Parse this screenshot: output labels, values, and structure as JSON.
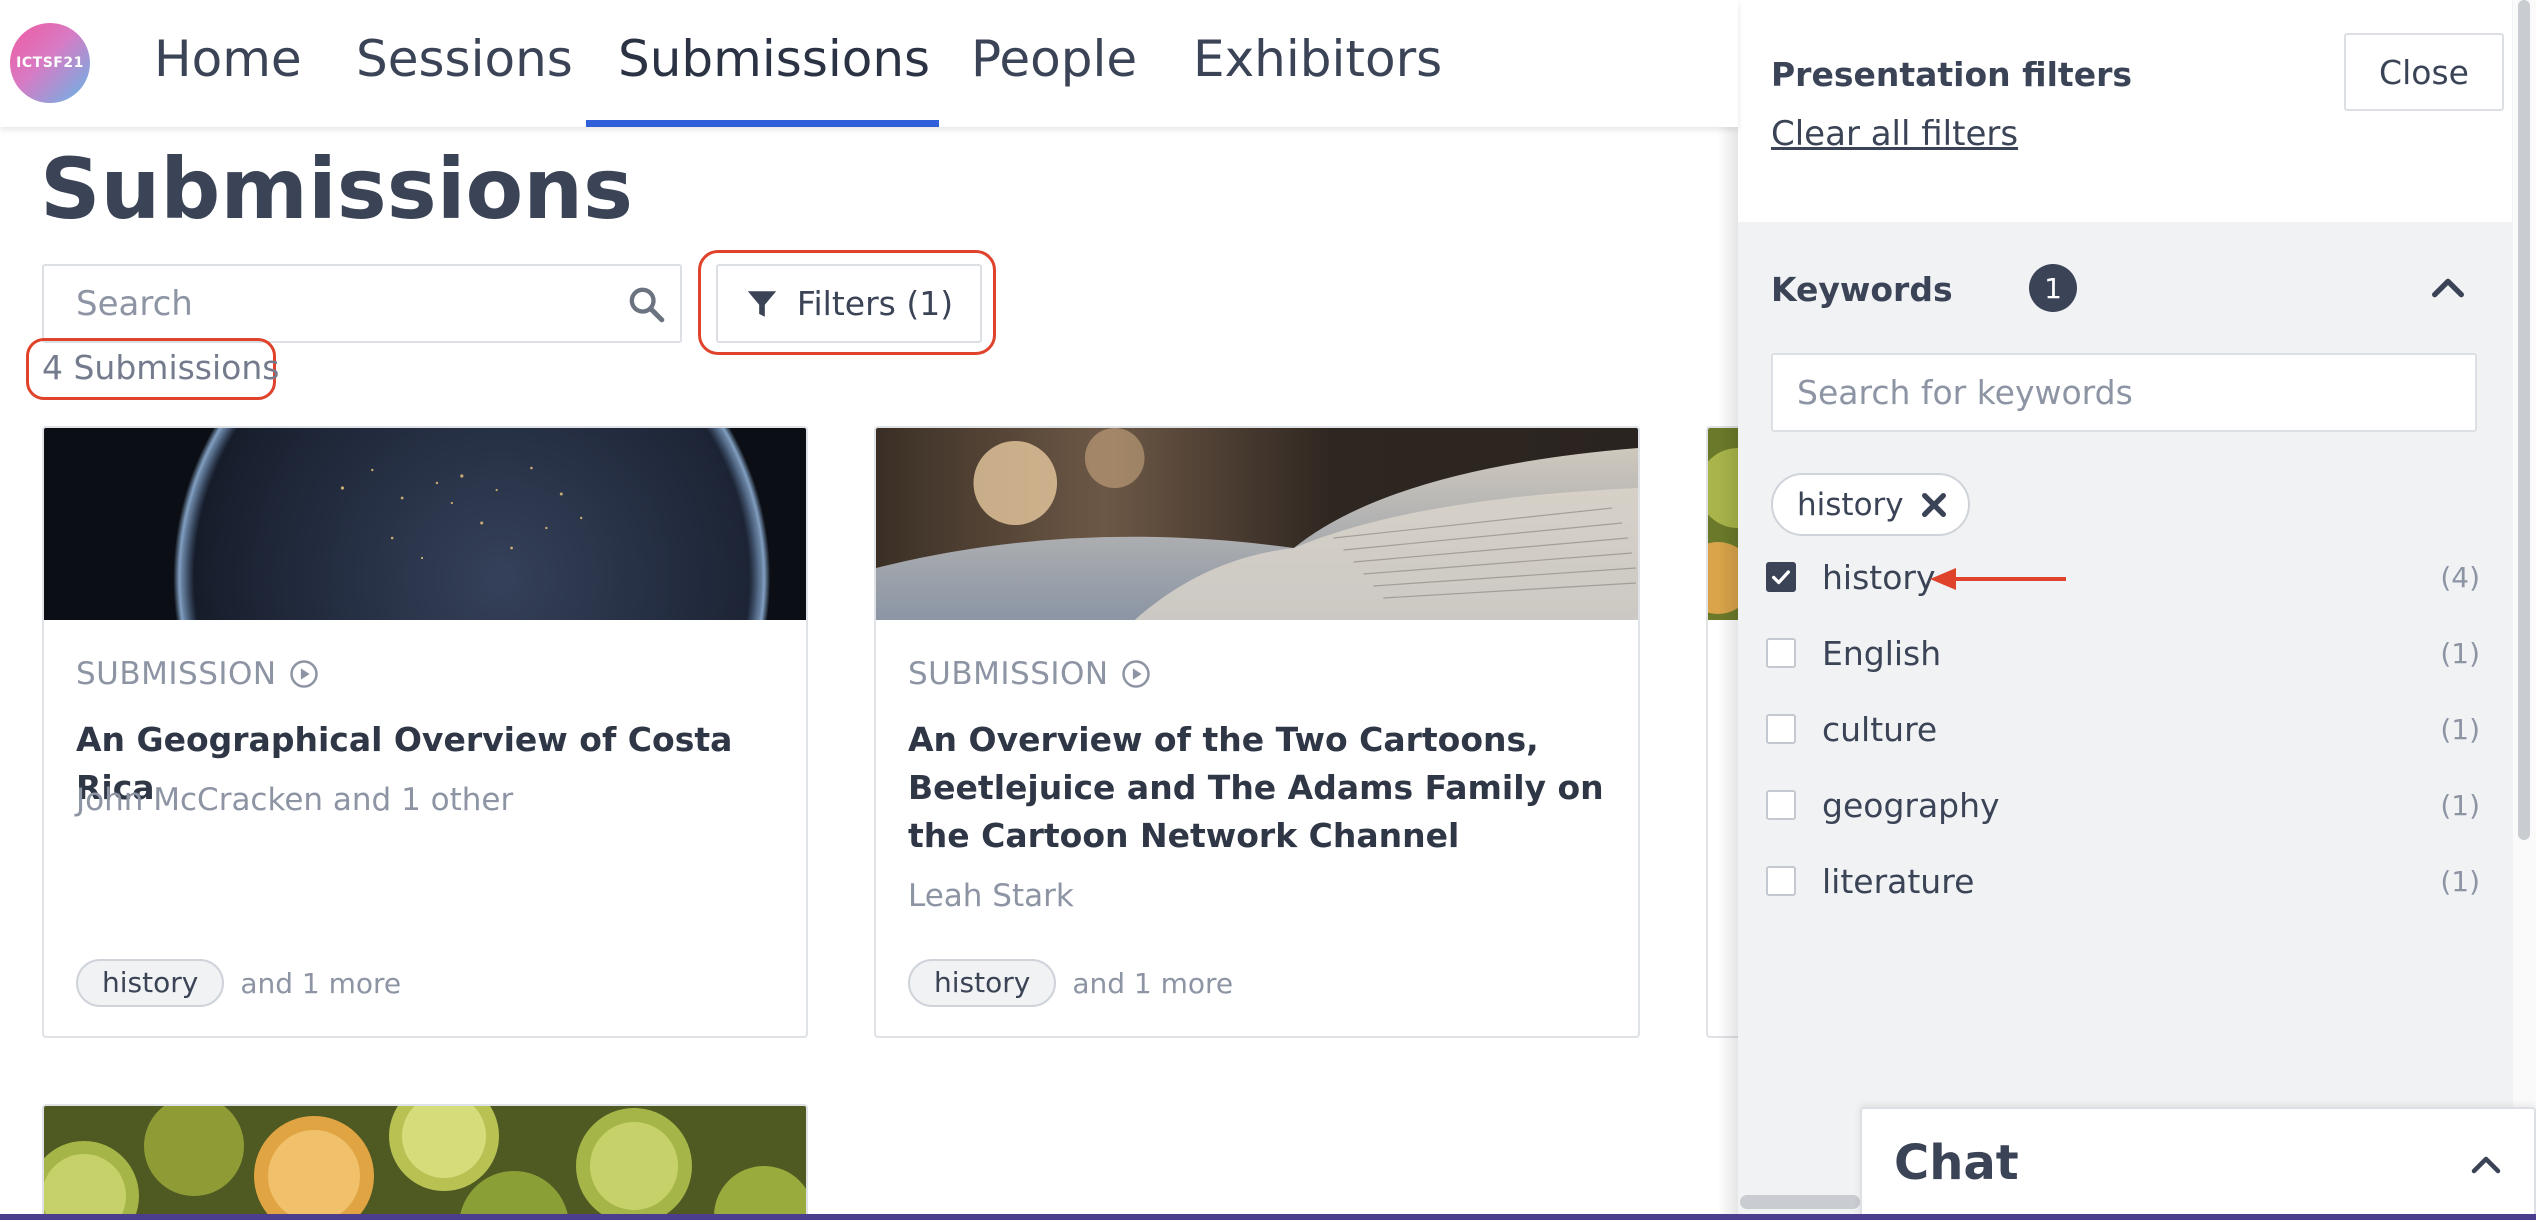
{
  "app": {
    "logo_text": "ICTSF21"
  },
  "nav": {
    "items": [
      {
        "label": "Home",
        "active": false
      },
      {
        "label": "Sessions",
        "active": false
      },
      {
        "label": "Submissions",
        "active": true
      },
      {
        "label": "People",
        "active": false
      },
      {
        "label": "Exhibitors",
        "active": false
      }
    ]
  },
  "main": {
    "title": "Submissions",
    "search_placeholder": "Search",
    "filters_label": "Filters (1)",
    "count_label": "4 Submissions"
  },
  "cards": [
    {
      "type_label": "SUBMISSION",
      "title": "An Geographical Overview of Costa Rica",
      "author": "John McCracken and 1 other",
      "tag": "history",
      "more": "and 1 more"
    },
    {
      "type_label": "SUBMISSION",
      "title": "An Overview of the Two Cartoons, Beetlejuice and The Adams Family on the Cartoon Network Channel",
      "author": "Leah Stark",
      "tag": "history",
      "more": "and 1 more"
    }
  ],
  "drawer": {
    "title": "Presentation filters",
    "clear_label": "Clear all filters",
    "close_label": "Close",
    "section_title": "Keywords",
    "section_count": "1",
    "keyword_search_placeholder": "Search for keywords",
    "selected_chip": "history",
    "keywords": [
      {
        "label": "history",
        "count": "(4)",
        "checked": true
      },
      {
        "label": "English",
        "count": "(1)",
        "checked": false
      },
      {
        "label": "culture",
        "count": "(1)",
        "checked": false
      },
      {
        "label": "geography",
        "count": "(1)",
        "checked": false
      },
      {
        "label": "literature",
        "count": "(1)",
        "checked": false
      }
    ]
  },
  "chat": {
    "title": "Chat"
  },
  "colors": {
    "accent": "#2f5fd9",
    "highlight": "#e0432c",
    "text": "#3b4456",
    "muted": "#8d94a3"
  }
}
